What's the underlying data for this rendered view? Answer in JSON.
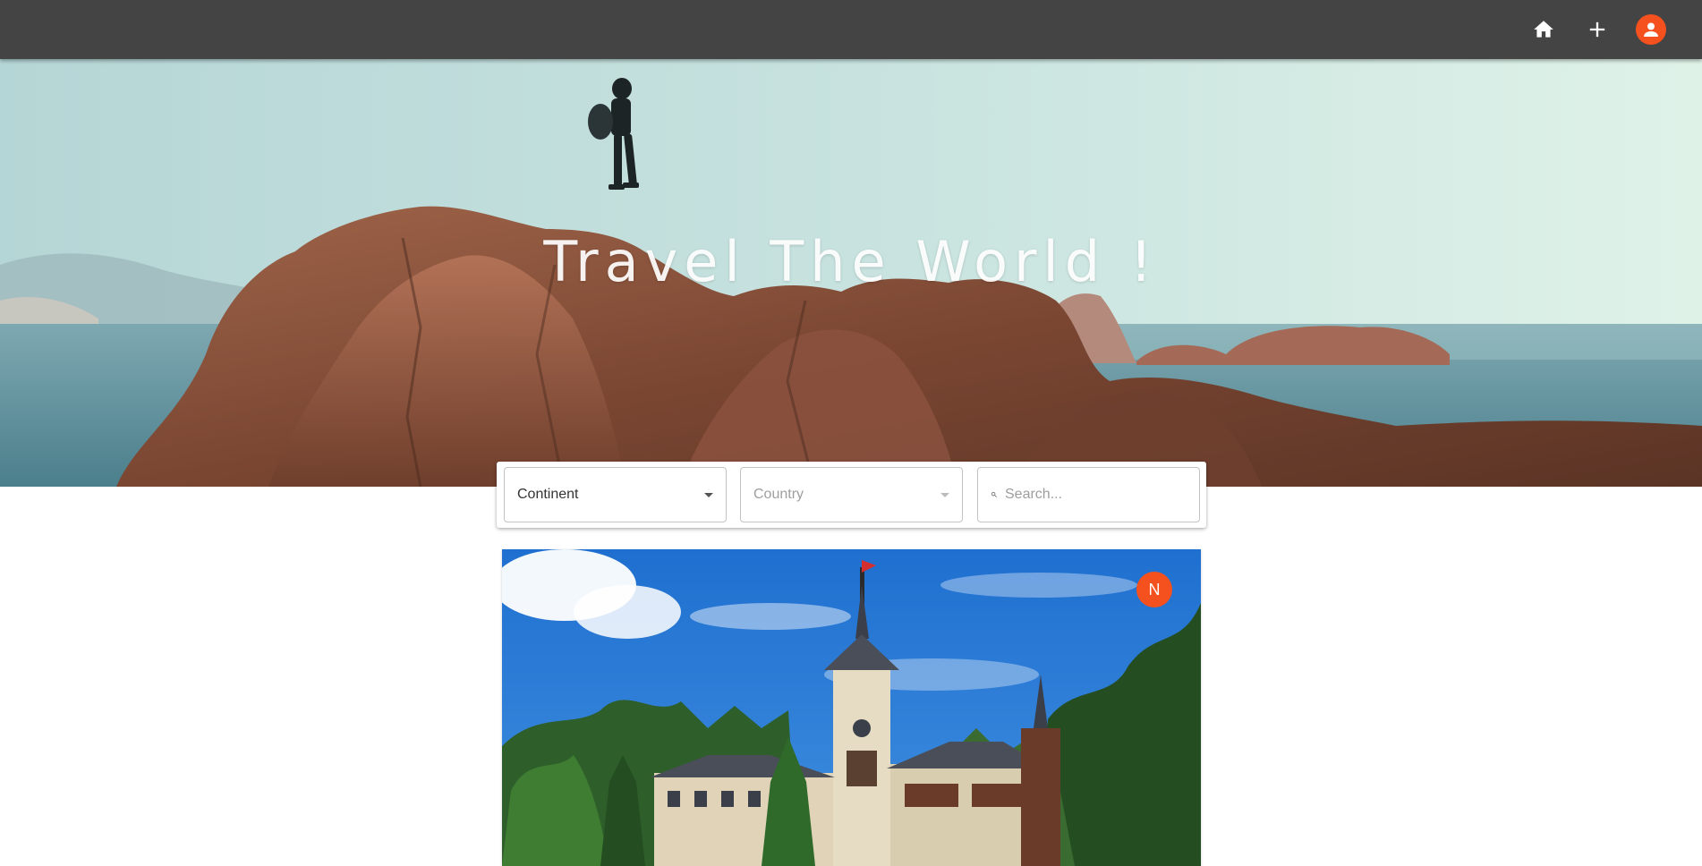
{
  "header": {
    "actions": [
      {
        "icon": "home-icon"
      },
      {
        "icon": "plus-icon"
      },
      {
        "icon": "account-icon"
      }
    ],
    "accent_color": "#f4511e"
  },
  "hero": {
    "title": "Travel The World !"
  },
  "filters": {
    "continent": {
      "value": "Continent"
    },
    "country": {
      "value": "Country"
    },
    "search": {
      "placeholder": "Search..."
    }
  },
  "posts": [
    {
      "author_initial": "N"
    }
  ],
  "colors": {
    "topbar": "#444444",
    "accent": "#f4511e"
  }
}
